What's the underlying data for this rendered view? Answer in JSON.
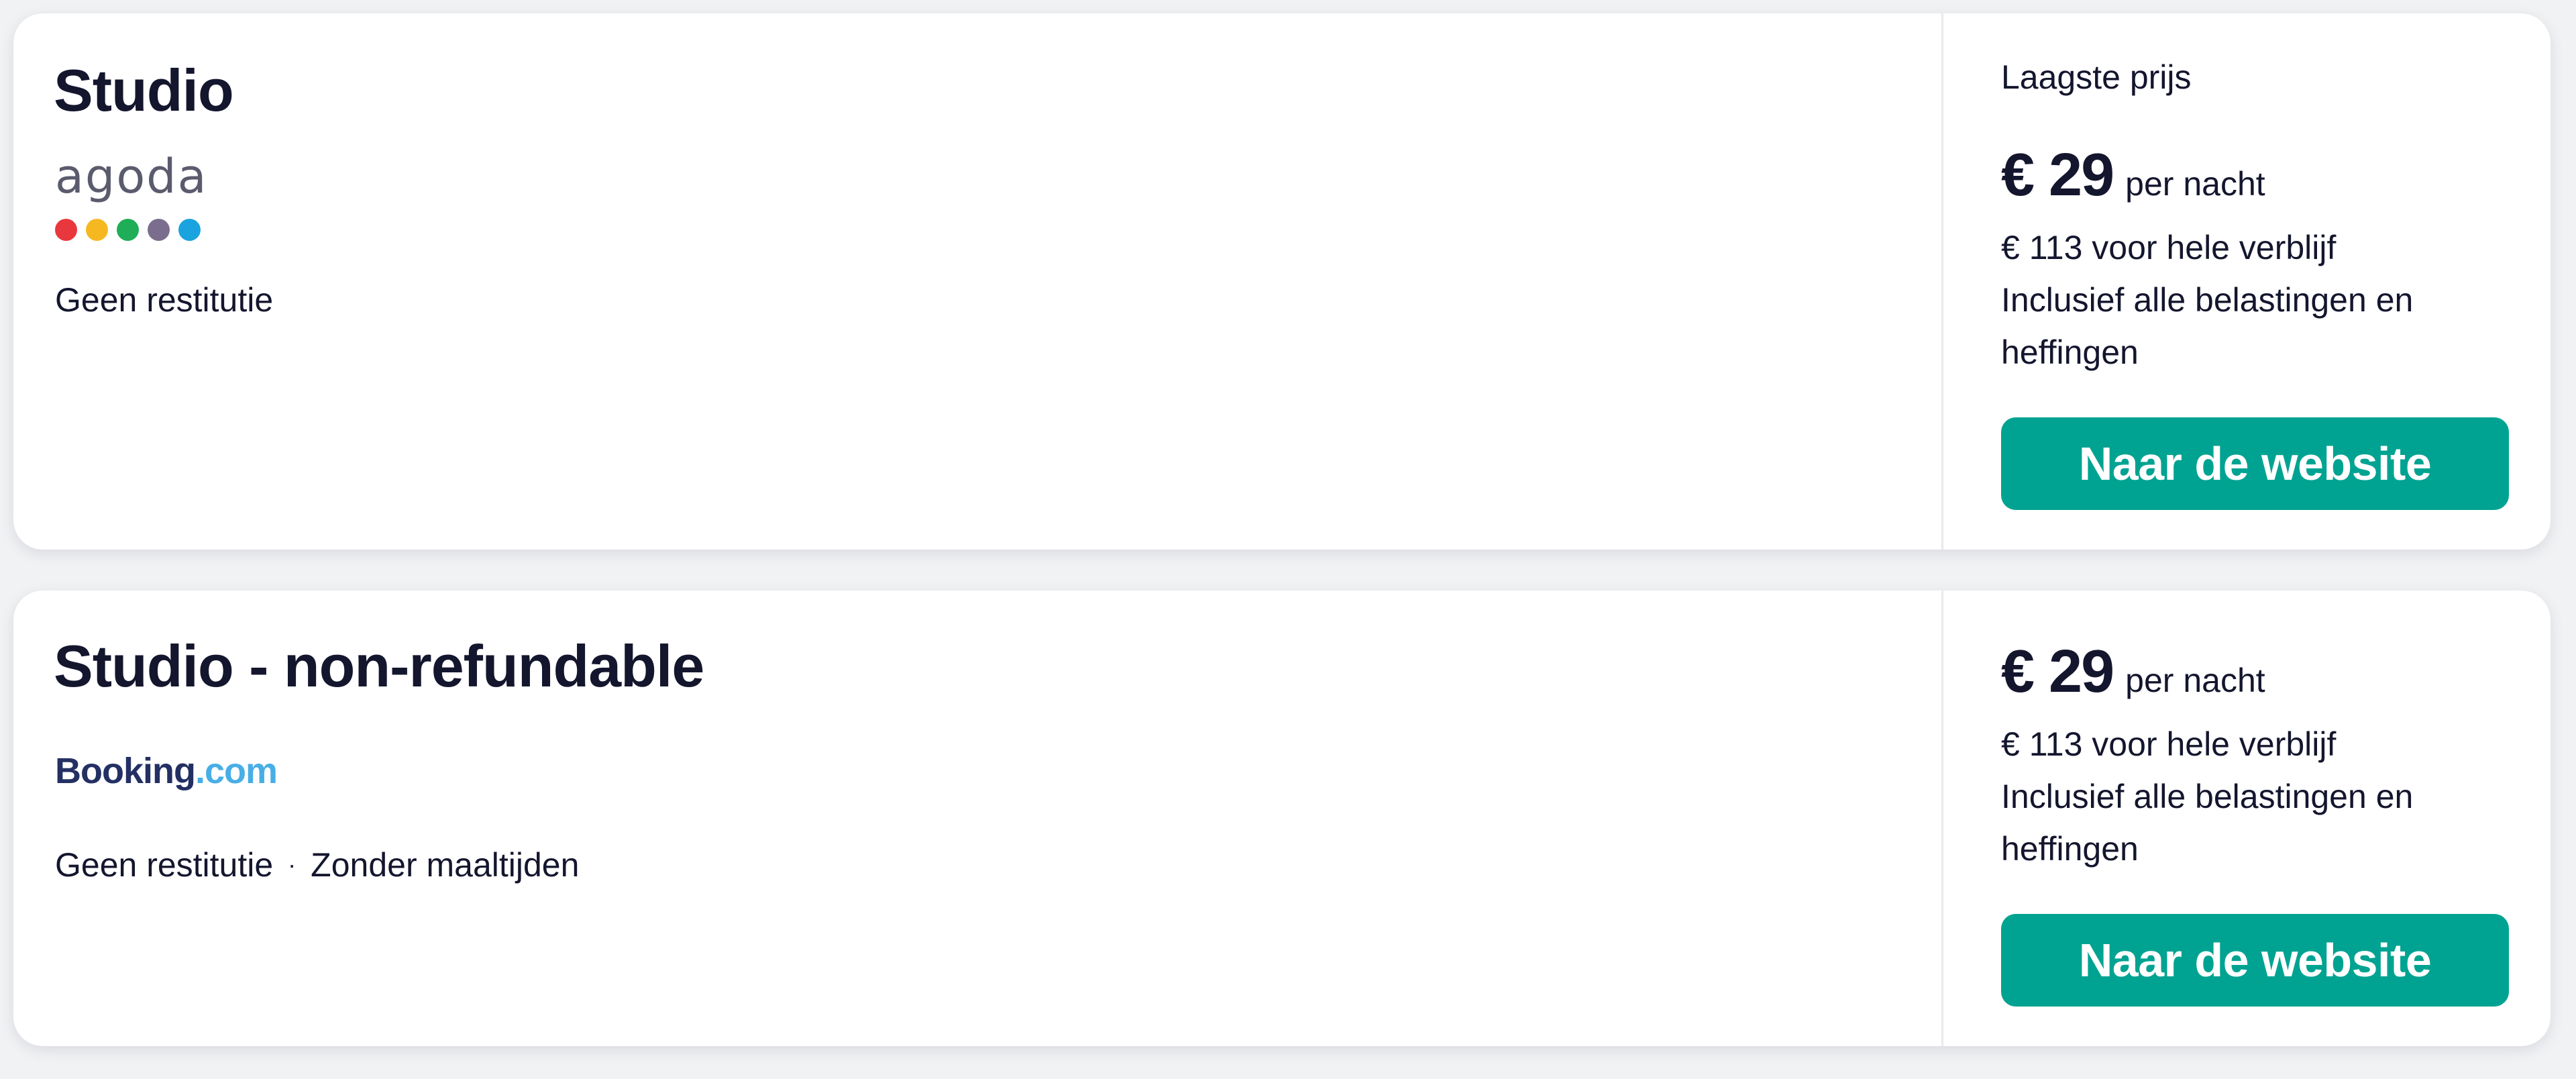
{
  "offers": [
    {
      "room_title": "Studio",
      "provider": {
        "name": "agoda",
        "logo_word": "agoda",
        "dot_colors": [
          "#e8383d",
          "#f6b820",
          "#1fae57",
          "#7b6d8d",
          "#1aa3df"
        ]
      },
      "features": [
        "Geen restitutie"
      ],
      "lowest_price_label": "Laagste prijs",
      "price": "€ 29",
      "price_unit": "per nacht",
      "total": "€ 113 voor hele verblijf",
      "taxes_note": "Inclusief alle belastingen en heffingen",
      "cta_label": "Naar de website"
    },
    {
      "room_title": "Studio - non-refundable",
      "provider": {
        "name": "Booking.com",
        "logo_part1": "Booking",
        "logo_part2": ".com"
      },
      "features": [
        "Geen restitutie",
        "Zonder maaltijden"
      ],
      "feature_separator": "·",
      "price": "€ 29",
      "price_unit": "per nacht",
      "total": "€ 113 voor hele verblijf",
      "taxes_note": "Inclusief alle belastingen en heffingen",
      "cta_label": "Naar de website"
    }
  ],
  "colors": {
    "accent": "#00a391",
    "text": "#14162e",
    "background": "#f1f2f4",
    "card": "#ffffff"
  }
}
